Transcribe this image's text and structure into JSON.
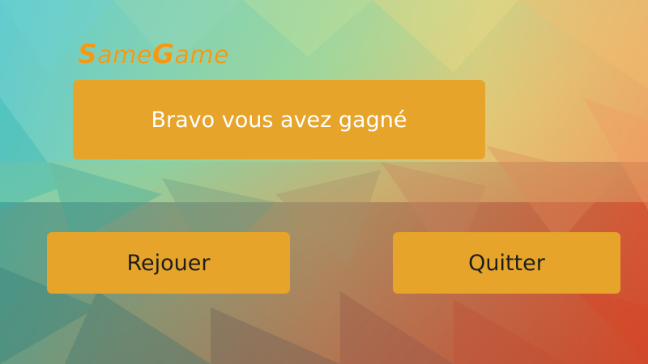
{
  "game": {
    "logo": {
      "cap1": "S",
      "rest1": "ame",
      "cap2": "G",
      "rest2": "ame"
    },
    "message": "Bravo vous avez gagné",
    "buttons": {
      "replay_label": "Rejouer",
      "quit_label": "Quitter"
    }
  },
  "colors": {
    "logo": "#f29a16",
    "panel": "#e6a42a",
    "message_text": "#ffffff",
    "button_text": "#1e1e1e"
  }
}
